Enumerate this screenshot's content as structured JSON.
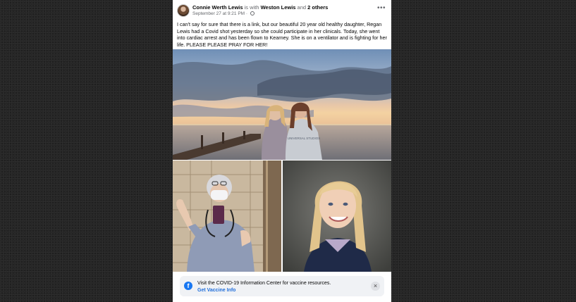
{
  "post": {
    "author": "Connie Werth Lewis",
    "with_text": "is with",
    "tagged_person": "Weston Lewis",
    "and_text": "and",
    "others": "2 others",
    "timestamp": "September 27 at 9:21 PM",
    "separator": "·",
    "more_icon": "•••",
    "body": "I can't say for sure that there is a link, but our beautiful 20 year old healthy daughter, Regan Lewis had a Covid shot yesterday so she could participate in her clinicals. Today, she went into cardiac arrest and has been flown to Kearney. She is on a ventilator and is fighting for her life. PLEASE PLEASE PRAY FOR HER!"
  },
  "photos": [
    {
      "name": "sunset-pier-photo",
      "caption": "UNIVERSAL STUDIOS"
    },
    {
      "name": "scrubs-selfie-photo"
    },
    {
      "name": "portrait-photo"
    }
  ],
  "info_bar": {
    "icon": "f",
    "text": "Visit the COVID-19 Information Center for vaccine resources.",
    "link": "Get Vaccine Info",
    "close": "×"
  },
  "colors": {
    "page_background": "#262626",
    "card": "#ffffff",
    "link_blue": "#216fdb",
    "facebook_blue": "#1877f2",
    "info_bar": "#f0f2f5"
  }
}
